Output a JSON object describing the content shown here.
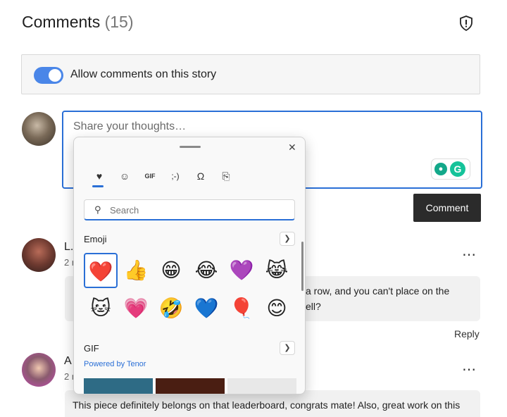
{
  "header": {
    "title": "Comments",
    "count": "(15)"
  },
  "allow": {
    "label": "Allow comments on this story",
    "enabled": true
  },
  "compose": {
    "placeholder": "Share your thoughts…",
    "submit_label": "Comment"
  },
  "comments": [
    {
      "name": "L.",
      "time": "2 r",
      "text": "a row, and you can't place on the",
      "text2": "ell?"
    },
    {
      "name": "A",
      "time": "2 r",
      "text": "This piece definitely belongs on that leaderboard, congrats mate! Also, great work on this"
    }
  ],
  "reply_label": "Reply",
  "emoji_panel": {
    "search_placeholder": "Search",
    "tabs": [
      "favorites-icon",
      "emoji-smiley-icon",
      "gif-icon",
      "kaomoji-icon",
      "symbols-icon",
      "clipboard-icon"
    ],
    "tab_glyphs": [
      "♥",
      "☺",
      "GIF",
      ";-)",
      "Ω",
      "⎘"
    ],
    "section_emoji": "Emoji",
    "emojis": [
      "❤️",
      "👍",
      "😁",
      "😂",
      "💜",
      "😹",
      "🐱",
      "💗",
      "🤣",
      "💙",
      "🎈",
      "😊"
    ],
    "section_gif": "GIF",
    "powered_by": "Powered by Tenor"
  }
}
